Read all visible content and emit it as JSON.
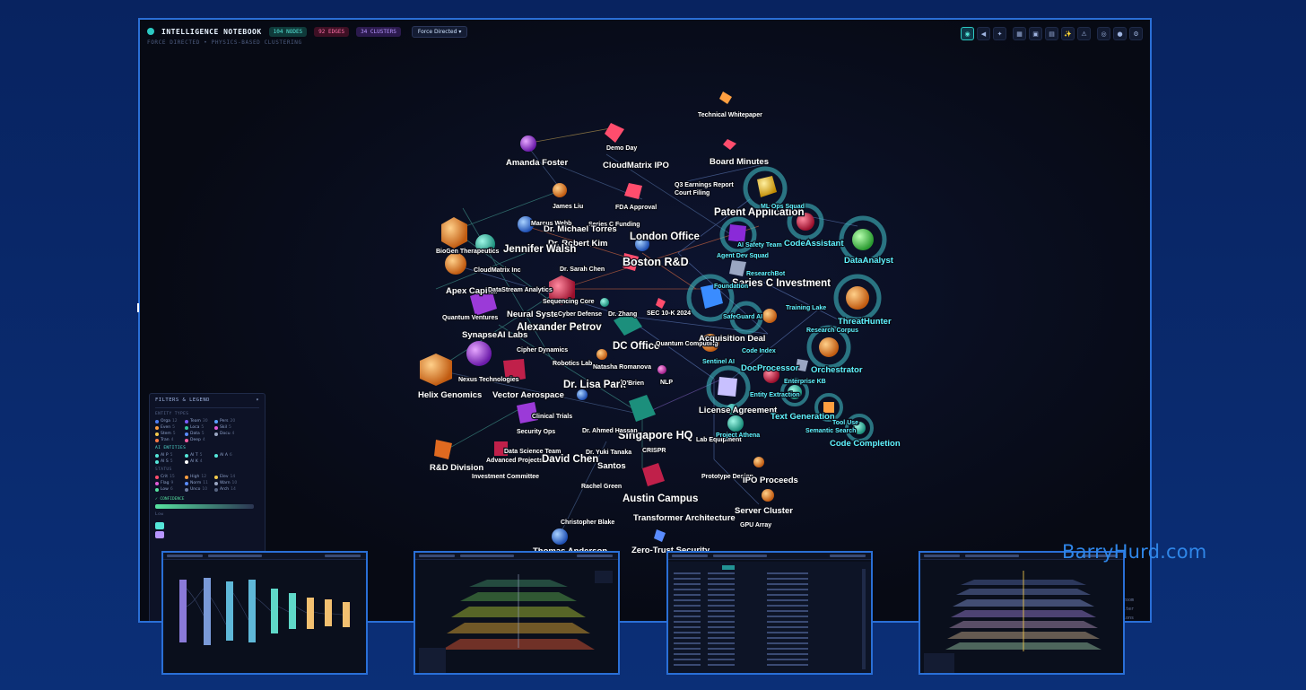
{
  "header": {
    "title": "INTELLIGENCE NOTEBOOK",
    "nodes_badge": "104 NODES",
    "edges_badge": "92 EDGES",
    "clusters_badge": "34 CLUSTERS",
    "layout_select": "Force Directed ▾",
    "subtitle": "FORCE DIRECTED • PHYSICS-BASED CLUSTERING"
  },
  "toolbar": {
    "buttons": [
      "graph-view-icon",
      "audio-icon",
      "target-icon",
      "grid-icon",
      "lock-icon",
      "image-icon",
      "spark-icon",
      "warning-icon",
      "eye-icon",
      "sun-icon",
      "settings-icon"
    ],
    "glyphs": [
      "◉",
      "◀",
      "✦",
      "▦",
      "▣",
      "▤",
      "✨",
      "⚠",
      "◎",
      "●",
      "⚙"
    ]
  },
  "colors": {
    "accent": "#2cc9c3",
    "ai_label": "#5ff3ff",
    "frame_border": "#2a6fd6",
    "watermark": "#2f86e8"
  },
  "graph": {
    "labels": [
      "Technical Whitepaper",
      "Demo Day",
      "Amanda Foster",
      "CloudMatrix IPO",
      "Board Minutes",
      "Q3 Earnings Report",
      "Court Filing",
      "FDA Approval",
      "James Liu",
      "Marcus Webb",
      "Series C Funding",
      "Dr. Michael Torres",
      "Dr. Robert Kim",
      "London Office",
      "Jennifer Walsh",
      "BioGen Therapeutics",
      "CloudMatrix Inc",
      "Dr. Sarah Chen",
      "Boston R&D",
      "Apex Capital",
      "DataStream Analytics",
      "Sequencing Core",
      "Quantum Ventures",
      "Neural Systems",
      "Cyber Defense",
      "Dr. Zhang",
      "SEC 10-K 2024",
      "Alexander Petrov",
      "SynapseAI Labs",
      "Cipher Dynamics",
      "DC Office",
      "Quantum Computing",
      "Robotics Lab",
      "Natasha Romanova",
      "Nexus Technologies",
      "Helix Genomics",
      "Vector Aerospace",
      "Dr. Lisa Park",
      "O'Brien",
      "NLP",
      "Clinical Trials",
      "Security Ops",
      "Singapore HQ",
      "Data Science Team",
      "Advanced Projects",
      "David Chen",
      "Dr. Ahmed Hassan",
      "Dr. Yuki Tanaka",
      "CRISPR",
      "R&D Division",
      "Investment Committee",
      "Santos",
      "Rachel Green",
      "Austin Campus",
      "Christopher Blake",
      "Transformer Architecture",
      "Thomas Anderson",
      "Zero-Trust Security",
      "Patent Application",
      "Series C Investment",
      "Acquisition Deal",
      "License Agreement",
      "Lab Equipment",
      "Prototype Design",
      "IPO Proceeds",
      "Server Cluster",
      "GPU Array"
    ],
    "ai_labels": [
      "ML Ops Squad",
      "AI Safety Team",
      "CodeAssistant",
      "DataAnalyst",
      "Agent Dev Squad",
      "ResearchBot",
      "Foundation",
      "Training Lake",
      "ThreatHunter",
      "SafeGuard AI",
      "Research Corpus",
      "Code Index",
      "Sentinel AI",
      "DocProcessor",
      "Orchestrator",
      "Enterprise KB",
      "Entity Extraction",
      "Text Generation",
      "Tool Use",
      "Semantic Search",
      "Project Athena",
      "Code Completion"
    ]
  },
  "filters": {
    "title": "FILTERS & LEGEND",
    "collapse": "▾",
    "entity_section": "ENTITY TYPES",
    "entity_types": [
      {
        "label": "Orga",
        "count": "12",
        "color": "#4e7cf2"
      },
      {
        "label": "Team",
        "count": "30",
        "color": "#7a5cff"
      },
      {
        "label": "Pers",
        "count": "20",
        "color": "#5aa0ff"
      },
      {
        "label": "Even",
        "count": "5",
        "color": "#ff9f40"
      },
      {
        "label": "Loca",
        "count": "5",
        "color": "#34c7a0"
      },
      {
        "label": "Skil",
        "count": "5",
        "color": "#e05ad7"
      },
      {
        "label": "Stem",
        "count": "5",
        "color": "#f2c94c"
      },
      {
        "label": "Data",
        "count": "5",
        "color": "#5a8cff"
      },
      {
        "label": "Docu",
        "count": "4",
        "color": "#9aa6c2"
      },
      {
        "label": "Tran",
        "count": "4",
        "color": "#ff7a45"
      },
      {
        "label": "Deep",
        "count": "4",
        "color": "#ff5fa2"
      }
    ],
    "ai_section": "AI ENTITIES",
    "ai_entities": [
      {
        "label": "AI P",
        "count": "5",
        "color": "#55e6d9"
      },
      {
        "label": "AI T",
        "count": "5",
        "color": "#55e6d9"
      },
      {
        "label": "AI A",
        "count": "6",
        "color": "#55e6d9"
      },
      {
        "label": "AI S",
        "count": "5",
        "color": "#55e6d9"
      },
      {
        "label": "AI K",
        "count": "4",
        "color": "#ffffff"
      }
    ],
    "status_section": "STATUS",
    "statuses": [
      {
        "label": "Crit",
        "count": "15",
        "color": "#ff4d6d"
      },
      {
        "label": "High",
        "count": "12",
        "color": "#ff9f40"
      },
      {
        "label": "Elev",
        "count": "14",
        "color": "#f2c94c"
      },
      {
        "label": "Flag",
        "count": "9",
        "color": "#e05ad7"
      },
      {
        "label": "Norm",
        "count": "11",
        "color": "#5a8cff"
      },
      {
        "label": "Warn",
        "count": "10",
        "color": "#9aa6c2"
      },
      {
        "label": "Low",
        "count": "6",
        "color": "#57e2a0"
      },
      {
        "label": "Unco",
        "count": "10",
        "color": "#6d7ca0"
      },
      {
        "label": "Arch",
        "count": "14",
        "color": "#55627f"
      }
    ],
    "confidence": "✓ CONFIDENCE",
    "confidence_low": "Low"
  },
  "hints": [
    "to zoom",
    "filter",
    "entions"
  ],
  "thumbnails": [
    "Flow view thumbnail",
    "Layered 3D view thumbnail",
    "Table view thumbnail",
    "Stacked layers thumbnail"
  ],
  "watermark": "BarryHurd.com"
}
